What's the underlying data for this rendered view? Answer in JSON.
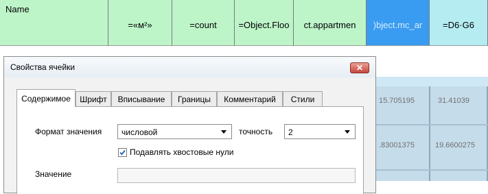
{
  "sheet": {
    "headers": [
      "Name",
      "=«м²»",
      "=count",
      "=Object.Floo",
      "ct.appartmen",
      ")bject.mc_ar",
      "=D6·G6"
    ],
    "cells": {
      "row1_col1": "15.705195",
      "row1_col2": "31.41039",
      "row2_col1": ".83001375",
      "row2_col2": "19.6600275"
    }
  },
  "dialog": {
    "title": "Свойства ячейки",
    "close_glyph": "✕",
    "tabs": [
      "Содержимое",
      "Шрифт",
      "Вписывание",
      "Границы",
      "Комментарий",
      "Стили"
    ],
    "active_tab": "Содержимое",
    "format_label": "Формат значения",
    "format_value": "числовой",
    "precision_label": "точность",
    "precision_value": "2",
    "suppress_zeros_label": "Подавлять хвостовые нули",
    "suppress_zeros_checked": true,
    "value_label": "Значение",
    "value_field": ""
  }
}
